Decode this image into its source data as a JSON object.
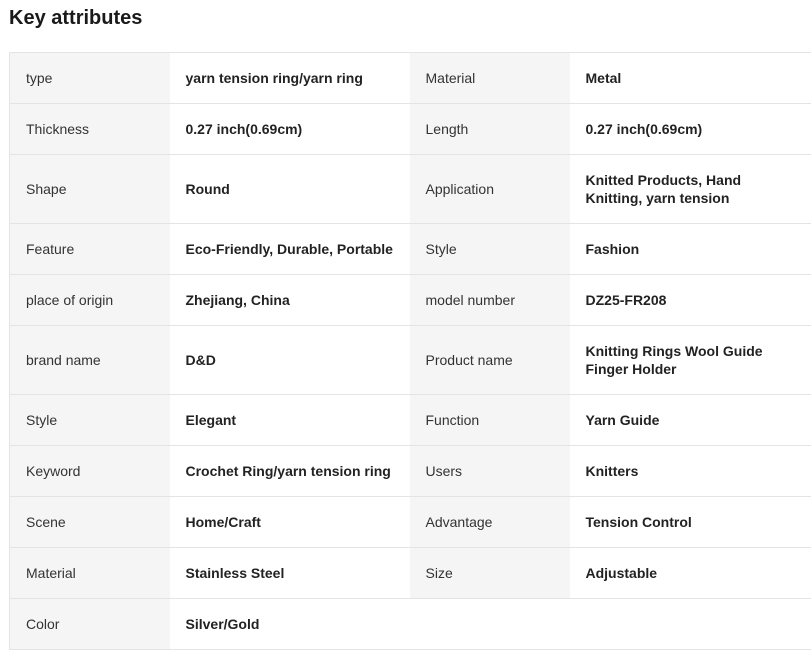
{
  "heading": "Key attributes",
  "rows": [
    {
      "k1": "type",
      "v1": "yarn tension ring/yarn ring",
      "k2": "Material",
      "v2": "Metal"
    },
    {
      "k1": "Thickness",
      "v1": "0.27 inch(0.69cm)",
      "k2": "Length",
      "v2": "0.27 inch(0.69cm)"
    },
    {
      "k1": "Shape",
      "v1": "Round",
      "k2": "Application",
      "v2": "Knitted Products, Hand Knitting, yarn tension"
    },
    {
      "k1": "Feature",
      "v1": "Eco-Friendly, Durable, Portable",
      "k2": "Style",
      "v2": "Fashion"
    },
    {
      "k1": "place of origin",
      "v1": "Zhejiang, China",
      "k2": "model number",
      "v2": "DZ25-FR208"
    },
    {
      "k1": "brand name",
      "v1": "D&D",
      "k2": "Product name",
      "v2": "Knitting Rings Wool Guide Finger Holder"
    },
    {
      "k1": "Style",
      "v1": "Elegant",
      "k2": "Function",
      "v2": "Yarn Guide"
    },
    {
      "k1": "Keyword",
      "v1": "Crochet Ring/yarn tension ring",
      "k2": "Users",
      "v2": "Knitters"
    },
    {
      "k1": "Scene",
      "v1": "Home/Craft",
      "k2": "Advantage",
      "v2": "Tension Control"
    },
    {
      "k1": "Material",
      "v1": "Stainless Steel",
      "k2": "Size",
      "v2": "Adjustable"
    },
    {
      "k1": "Color",
      "v1": "Silver/Gold",
      "k2": "",
      "v2": ""
    }
  ]
}
